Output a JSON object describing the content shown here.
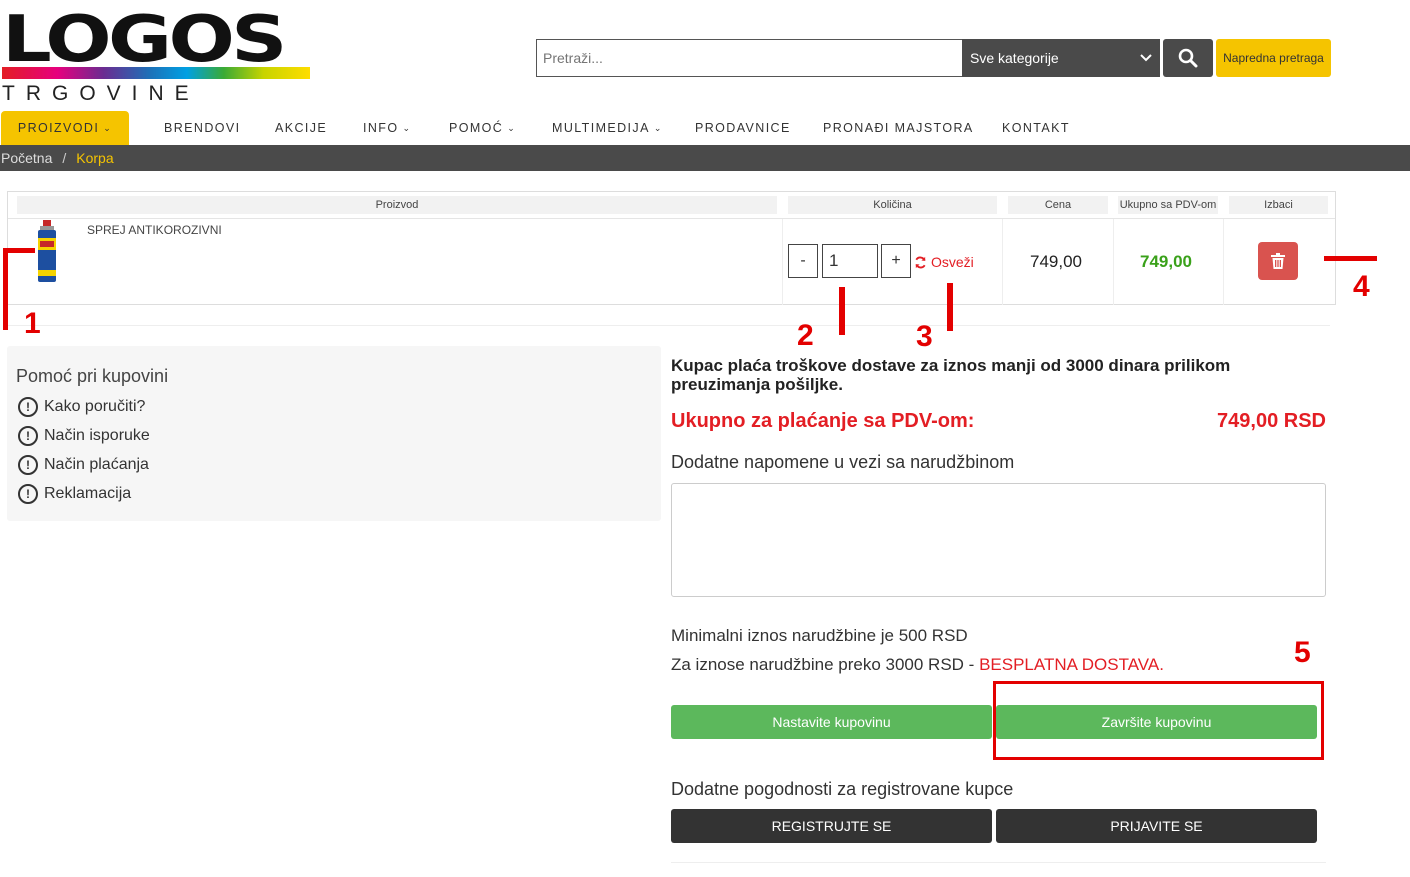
{
  "logo": {
    "word": "LOGOS",
    "sub": "TRGOVINE"
  },
  "search": {
    "placeholder": "Pretraži...",
    "category": "Sve kategorije",
    "advanced_label": "Napredna pretraga"
  },
  "nav": [
    {
      "label": "PROIZVODI",
      "caret": true
    },
    {
      "label": "BRENDOVI",
      "caret": false
    },
    {
      "label": "AKCIJE",
      "caret": false
    },
    {
      "label": "INFO",
      "caret": true
    },
    {
      "label": "POMOĆ",
      "caret": true
    },
    {
      "label": "MULTIMEDIJA",
      "caret": true
    },
    {
      "label": "PRODAVNICE",
      "caret": false
    },
    {
      "label": "PRONAĐI MAJSTORA",
      "caret": false
    },
    {
      "label": "KONTAKT",
      "caret": false
    }
  ],
  "breadcrumb": {
    "home": "Početna",
    "sep": "/",
    "current": "Korpa"
  },
  "cart": {
    "headers": {
      "product": "Proizvod",
      "qty": "Količina",
      "price": "Cena",
      "total": "Ukupno sa PDV-om",
      "remove": "Izbaci"
    },
    "item": {
      "name": "SPREJ ANTIKOROZIVNI",
      "qty": "1",
      "price": "749,00",
      "total": "749,00"
    },
    "minus": "-",
    "plus": "+",
    "refresh_label": "Osveži"
  },
  "annotations": [
    "1",
    "2",
    "3",
    "4",
    "5"
  ],
  "help": {
    "title": "Pomoć pri kupovini",
    "items": [
      "Kako poručiti?",
      "Način isporuke",
      "Način plaćanja",
      "Reklamacija"
    ]
  },
  "summary": {
    "info": "Kupac plaća troškove dostave za iznos manji od 3000 dinara prilikom preuzimanja pošiljke.",
    "total_label": "Ukupno za plaćanje sa PDV-om:",
    "total_value": "749,00 RSD",
    "notes_label": "Dodatne napomene u vezi sa narudžbinom",
    "min_order": "Minimalni iznos narudžbine je 500 RSD",
    "free_prefix": "Za iznose narudžbine preko 3000 RSD - ",
    "free_highlight": "BESPLATNA DOSTAVA.",
    "continue_label": "Nastavite kupovinu",
    "finish_label": "Završite kupovinu",
    "reg_label": "Dodatne pogodnosti za registrovane kupce",
    "register_label": "REGISTRUJTE SE",
    "login_label": "PRIJAVITE SE"
  },
  "colors": {
    "accent": "#f5c400",
    "dark": "#4a4a4a",
    "green": "#5cb85c",
    "red": "#e31e24",
    "danger": "#d9534f",
    "annotation": "#e30000"
  }
}
